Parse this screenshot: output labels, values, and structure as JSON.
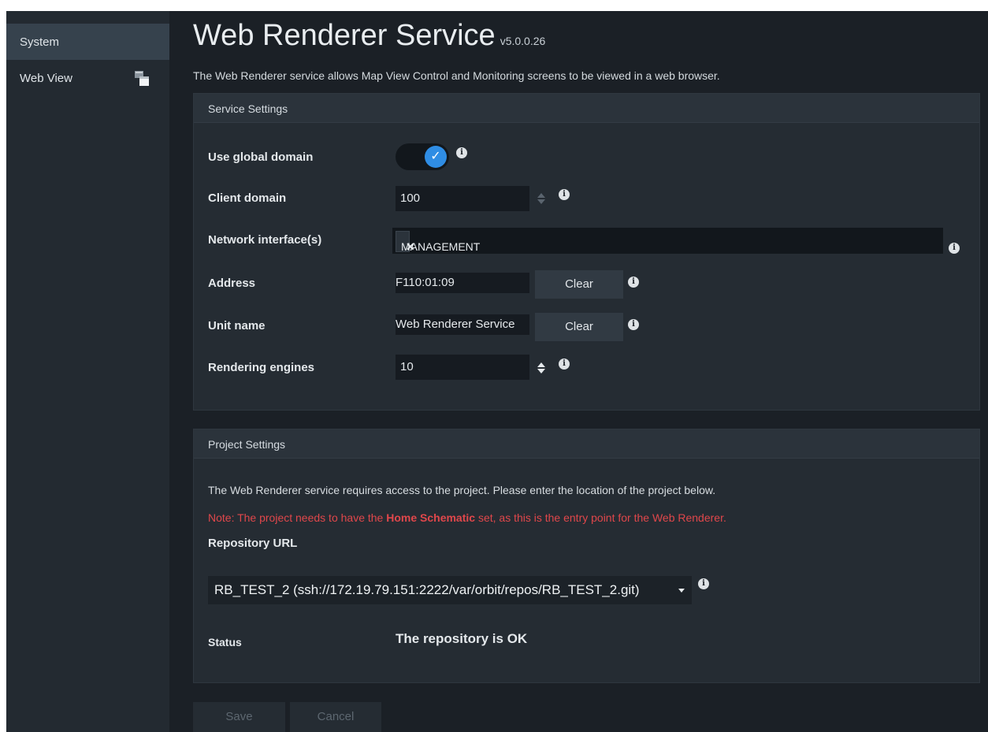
{
  "sidebar": {
    "items": [
      {
        "label": "System",
        "active": true
      },
      {
        "label": "Web View",
        "icon": "window-stack-icon"
      }
    ]
  },
  "header": {
    "title": "Web Renderer Service",
    "version": "v5.0.0.26",
    "description": "The Web Renderer service allows Map View Control and Monitoring screens to be viewed in a web browser."
  },
  "service_settings": {
    "title": "Service Settings",
    "use_global_domain": {
      "label": "Use global domain",
      "checked": true
    },
    "client_domain": {
      "label": "Client domain",
      "value": "100"
    },
    "network_interfaces": {
      "label": "Network interface(s)",
      "tags": [
        "MANAGEMENT"
      ],
      "remove_glyph": "✕"
    },
    "address": {
      "label": "Address",
      "value": "F110:01:09",
      "clear_label": "Clear"
    },
    "unit_name": {
      "label": "Unit name",
      "value": "Web Renderer Service",
      "clear_label": "Clear"
    },
    "rendering_engines": {
      "label": "Rendering engines",
      "value": "10"
    }
  },
  "project_settings": {
    "title": "Project Settings",
    "intro": "The Web Renderer service requires access to the project. Please enter the location of the project below.",
    "note_prefix": "Note: The project needs to have the ",
    "note_bold": "Home Schematic",
    "note_suffix": " set, as this is the entry point for the Web Renderer.",
    "repository_label": "Repository URL",
    "repository_value": "RB_TEST_2 (ssh://172.19.79.151:2222/var/orbit/repos/RB_TEST_2.git)",
    "status_label": "Status",
    "status_value": "The repository is OK"
  },
  "footer": {
    "save_label": "Save",
    "cancel_label": "Cancel"
  },
  "colors": {
    "accent": "#2f8de4",
    "warning_text": "#e0474b",
    "background": "#1b2026"
  },
  "info_glyph": "i",
  "check_glyph": "✓"
}
